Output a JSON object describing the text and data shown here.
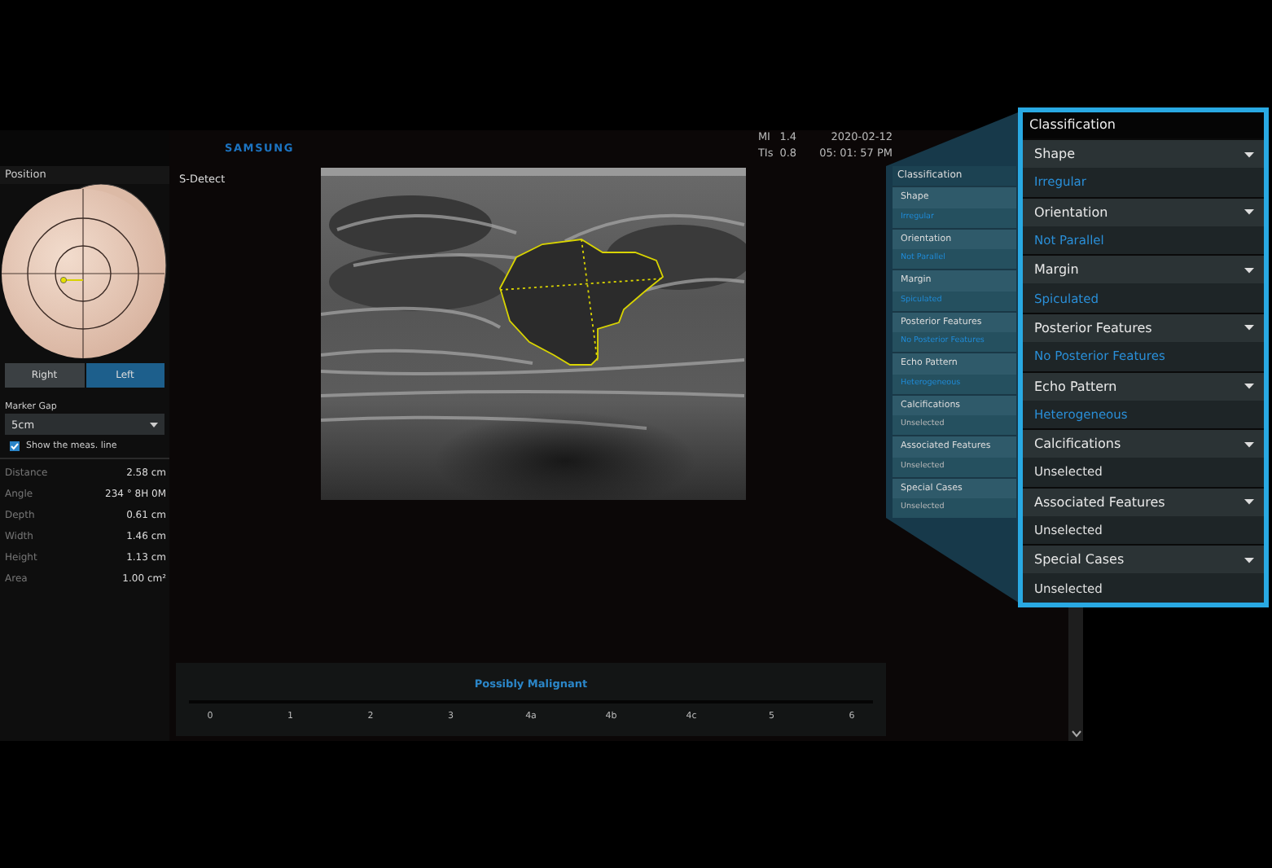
{
  "header": {
    "logo": "SAMSUNG",
    "mi_label": "MI",
    "mi": "1.4",
    "tis_label": "TIs",
    "tis": "0.8",
    "date": "2020-02-12",
    "time": "05: 01: 57 PM"
  },
  "left_panel": {
    "title": "Position",
    "sides": [
      {
        "label": "Right",
        "selected": false
      },
      {
        "label": "Left",
        "selected": true
      }
    ],
    "marker_gap": {
      "label": "Marker Gap",
      "value": "5cm"
    },
    "show_line": {
      "label": "Show the meas. line",
      "checked": true
    },
    "measurements": [
      {
        "name": "Distance",
        "value": "2.58 cm"
      },
      {
        "name": "Angle",
        "value": "234 °  8H 0M"
      },
      {
        "name": "Depth",
        "value": "0.61 cm"
      },
      {
        "name": "Width",
        "value": "1.46 cm"
      },
      {
        "name": "Height",
        "value": "1.13 cm"
      },
      {
        "name": "Area",
        "value": "1.00 cm²"
      }
    ]
  },
  "view": {
    "title": "S-Detect"
  },
  "result": {
    "assessment": "Possibly Malignant",
    "scale": [
      "0",
      "1",
      "2",
      "3",
      "4a",
      "4b",
      "4c",
      "5",
      "6"
    ]
  },
  "classification": {
    "title": "Classification",
    "features": [
      {
        "name": "Shape",
        "value": "Irregular",
        "selected": true
      },
      {
        "name": "Orientation",
        "value": "Not Parallel",
        "selected": true
      },
      {
        "name": "Margin",
        "value": "Spiculated",
        "selected": true
      },
      {
        "name": "Posterior Features",
        "value": "No Posterior Features",
        "selected": true
      },
      {
        "name": "Echo Pattern",
        "value": "Heterogeneous",
        "selected": true
      },
      {
        "name": "Calcifications",
        "value": "Unselected",
        "selected": false
      },
      {
        "name": "Associated Features",
        "value": "Unselected",
        "selected": false
      },
      {
        "name": "Special Cases",
        "value": "Unselected",
        "selected": false
      }
    ]
  },
  "detail": {
    "title": "Classification",
    "features": [
      {
        "name": "Shape",
        "value": "Irregular",
        "selected": true
      },
      {
        "name": "Orientation",
        "value": "Not Parallel",
        "selected": true
      },
      {
        "name": "Margin",
        "value": "Spiculated",
        "selected": true
      },
      {
        "name": "Posterior Features",
        "value": "No Posterior Features",
        "selected": true
      },
      {
        "name": "Echo Pattern",
        "value": "Heterogeneous",
        "selected": true
      },
      {
        "name": "Calcifications",
        "value": "Unselected",
        "selected": false
      },
      {
        "name": "Associated Features",
        "value": "Unselected",
        "selected": false
      },
      {
        "name": "Special Cases",
        "value": "Unselected",
        "selected": false
      }
    ]
  }
}
